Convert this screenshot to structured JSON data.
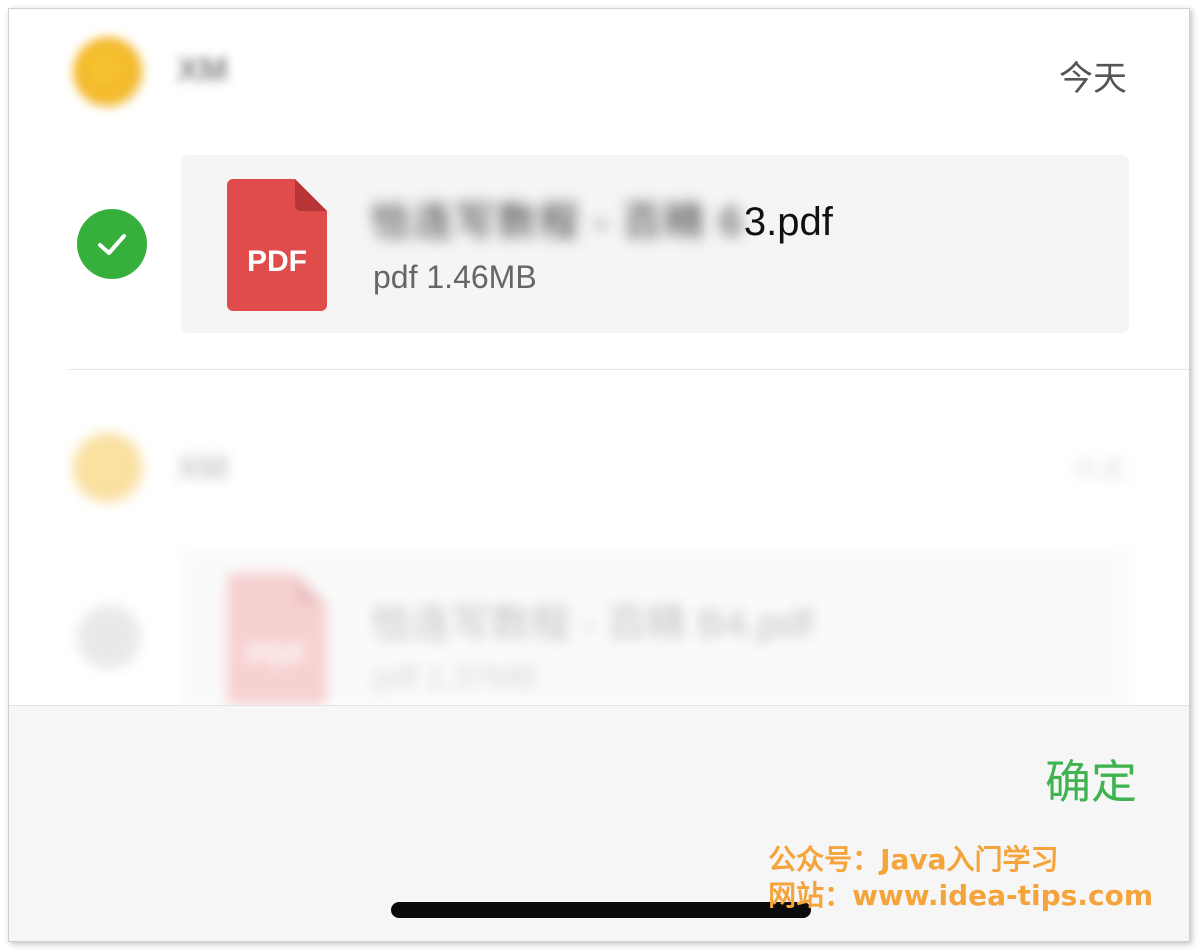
{
  "messages": [
    {
      "sender": "XM",
      "date": "今天",
      "file": {
        "name_blurred": "恰连写数程 - 百精 6",
        "name_suffix": "3.pdf",
        "size": "pdf 1.46MB",
        "icon_label": "PDF"
      },
      "selected": true
    },
    {
      "sender": "XM",
      "date": "今天",
      "file": {
        "name_blurred": "恰连写数程 - 百精 B4.pdf",
        "name_suffix": "",
        "size": "pdf 1.37MB",
        "icon_label": "PDF"
      },
      "selected": false
    }
  ],
  "footer": {
    "confirm_label": "确定"
  },
  "watermark": {
    "line1": "公众号：Java入门学习",
    "line2": "网站：www.idea-tips.com"
  },
  "colors": {
    "accent_green": "#36b03b",
    "confirm_green": "#3fb34f",
    "pdf_red": "#e04c4c",
    "watermark_orange": "#f5a43b"
  }
}
